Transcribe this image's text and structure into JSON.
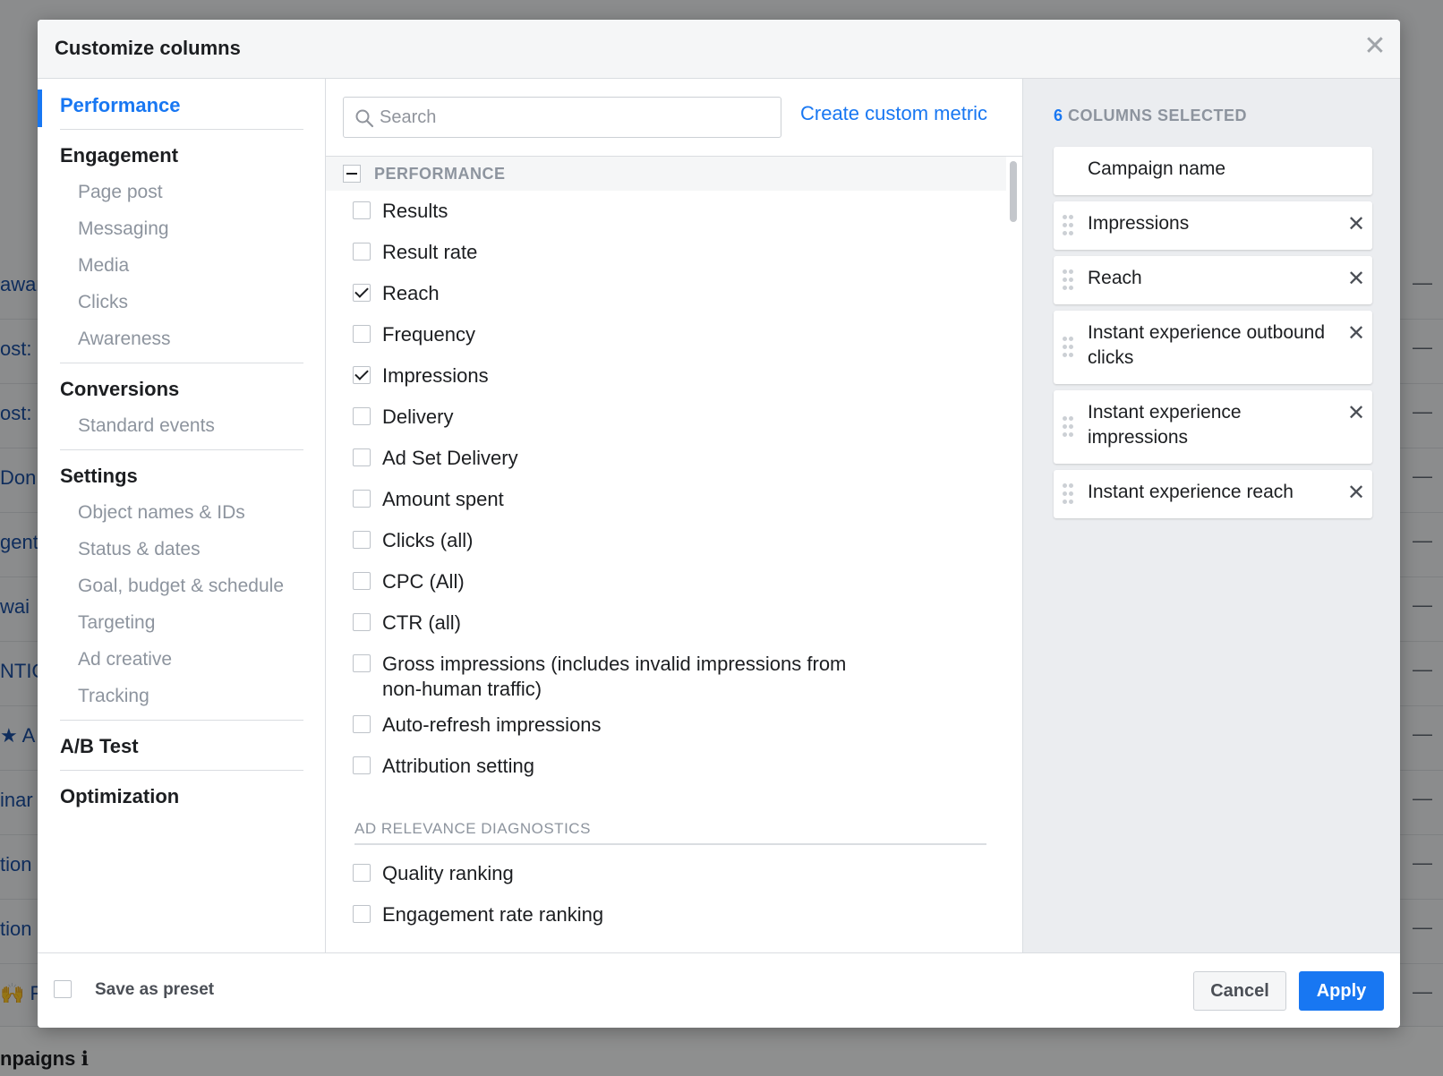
{
  "modal": {
    "title": "Customize columns",
    "close_glyph": "✕"
  },
  "background": {
    "left_fragments": [
      "awar",
      "ost:",
      "ost:",
      " Don",
      "gents",
      " wai",
      "NTIO",
      "★ A",
      "inar",
      "tion (",
      "tion (",
      "🙌 F"
    ],
    "footer_fragment": "npaigns ℹ",
    "dash": "—"
  },
  "nav": {
    "groups": [
      {
        "label": "Performance",
        "active": true,
        "items": []
      },
      {
        "label": "Engagement",
        "active": false,
        "items": [
          "Page post",
          "Messaging",
          "Media",
          "Clicks",
          "Awareness"
        ]
      },
      {
        "label": "Conversions",
        "active": false,
        "items": [
          "Standard events"
        ]
      },
      {
        "label": "Settings",
        "active": false,
        "items": [
          "Object names & IDs",
          "Status & dates",
          "Goal, budget & schedule",
          "Targeting",
          "Ad creative",
          "Tracking"
        ]
      },
      {
        "label": "A/B Test",
        "active": false,
        "items": []
      },
      {
        "label": "Optimization",
        "active": false,
        "items": []
      }
    ]
  },
  "middle": {
    "search_placeholder": "Search",
    "search_icon": "search-icon",
    "create_metric_label": "Create custom metric",
    "section_label": "PERFORMANCE",
    "metrics": [
      {
        "label": "Results",
        "checked": false
      },
      {
        "label": "Result rate",
        "checked": false
      },
      {
        "label": "Reach",
        "checked": true
      },
      {
        "label": "Frequency",
        "checked": false
      },
      {
        "label": "Impressions",
        "checked": true
      },
      {
        "label": "Delivery",
        "checked": false
      },
      {
        "label": "Ad Set Delivery",
        "checked": false
      },
      {
        "label": "Amount spent",
        "checked": false
      },
      {
        "label": "Clicks (all)",
        "checked": false
      },
      {
        "label": "CPC (All)",
        "checked": false
      },
      {
        "label": "CTR (all)",
        "checked": false
      },
      {
        "label": "Gross impressions (includes invalid impressions from non-human traffic)",
        "checked": false
      },
      {
        "label": "Auto-refresh impressions",
        "checked": false
      },
      {
        "label": "Attribution setting",
        "checked": false
      }
    ],
    "subsection_label": "AD RELEVANCE DIAGNOSTICS",
    "sub_metrics": [
      {
        "label": "Quality ranking",
        "checked": false
      },
      {
        "label": "Engagement rate ranking",
        "checked": false
      }
    ]
  },
  "right": {
    "selected_count": "6",
    "selected_suffix": "COLUMNS SELECTED",
    "remove_glyph": "✕",
    "columns": [
      {
        "label": "Campaign name",
        "removable": false
      },
      {
        "label": "Impressions",
        "removable": true
      },
      {
        "label": "Reach",
        "removable": true
      },
      {
        "label": "Instant experience outbound clicks",
        "removable": true
      },
      {
        "label": "Instant experience impressions",
        "removable": true
      },
      {
        "label": "Instant experience reach",
        "removable": true
      }
    ]
  },
  "footer": {
    "preset_label": "Save as preset",
    "cancel_label": "Cancel",
    "apply_label": "Apply"
  },
  "colors": {
    "accent": "#1877f2",
    "muted": "#8d949e"
  }
}
